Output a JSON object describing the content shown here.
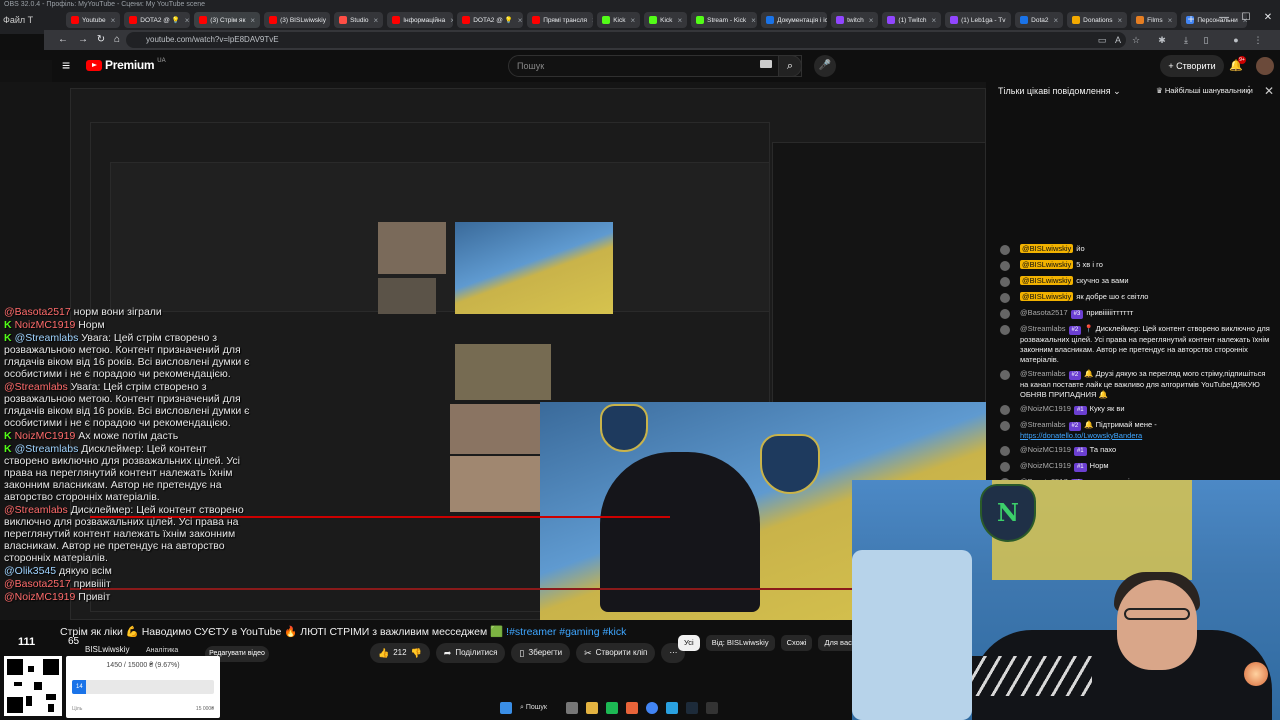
{
  "obs_title": "OBS 32.0.4 - Профіль: MyYouTube - Сцени: My YouTube scene",
  "left_menu": "Файл Т",
  "tabs": [
    {
      "label": "Youtube",
      "color": "#ff0000"
    },
    {
      "label": "DOTA2 @ 💡",
      "color": "#ff0000"
    },
    {
      "label": "(3) Стрім як",
      "color": "#ff0000",
      "active": true
    },
    {
      "label": "(3) BISLwiwskiy",
      "color": "#ff0000"
    },
    {
      "label": "Studio",
      "color": "#ff4e45"
    },
    {
      "label": "Інформаційна",
      "color": "#ff0000"
    },
    {
      "label": "DOTA2 @ 💡",
      "color": "#ff0000"
    },
    {
      "label": "Прямі трансля",
      "color": "#ff0000"
    },
    {
      "label": "Kick",
      "color": "#53fc18"
    },
    {
      "label": "Kick",
      "color": "#53fc18"
    },
    {
      "label": "Stream - Kick",
      "color": "#53fc18"
    },
    {
      "label": "Документація і історія",
      "color": "#1a73e8"
    },
    {
      "label": "twitch",
      "color": "#9146ff"
    },
    {
      "label": "(1) Twitch",
      "color": "#9146ff"
    },
    {
      "label": "(1) Leb1ga - Tv",
      "color": "#9146ff"
    },
    {
      "label": "Dota2",
      "color": "#1a73e8"
    },
    {
      "label": "Donations",
      "color": "#f2a900"
    },
    {
      "label": "Films",
      "color": "#e67e22"
    },
    {
      "label": "Персональни",
      "color": "#4285f4"
    }
  ],
  "address": "youtube.com/watch?v=lpE8DAV9TvE",
  "yt": {
    "logo": "Premium",
    "region": "UA",
    "search_placeholder": "Пошук",
    "create_label": "Створити",
    "notif_count": "9+"
  },
  "overlay_chat": [
    {
      "name": "@Basota2517",
      "red": true,
      "text": "норм вони зіграли",
      "kick": false
    },
    {
      "name": "NoizMC1919",
      "red": true,
      "text": "Норм",
      "kick": true
    },
    {
      "name": "@Streamlabs",
      "red": false,
      "text": "Увага: Цей стрім створено з розважальною метою. Контент призначений для глядачів віком від 16 років. Всі висловлені думки є особистими і не є порадою чи рекомендацією.",
      "kick": true
    },
    {
      "name": "@Streamlabs",
      "red": true,
      "text": "Увага: Цей стрім створено з розважальною метою. Контент призначений для глядачів віком від 16 років. Всі висловлені думки є особистими і не є порадою чи рекомендацією.",
      "kick": false
    },
    {
      "name": "NoizMC1919",
      "red": true,
      "text": "Ах може потім дасть",
      "kick": true
    },
    {
      "name": "@Streamlabs",
      "red": false,
      "text": "Дисклеймер: Цей контент створено виключно для розважальних цілей. Усі права на переглянутий контент належать їхнім законним власникам. Автор не претендує на авторство сторонніх матеріалів.",
      "kick": true
    },
    {
      "name": "@Streamlabs",
      "red": true,
      "text": "Дисклеймер: Цей контент створено виключно для розважальних цілей. Усі права на переглянутий контент належать їхнім законним власникам. Автор не претендує на авторство сторонніх матеріалів.",
      "kick": false
    },
    {
      "name": "@Olik3545",
      "red": false,
      "text": "дякую всім",
      "kick": false
    },
    {
      "name": "@Basota2517",
      "red": true,
      "text": "привііііт",
      "kick": false
    },
    {
      "name": "@NoizMC1919",
      "red": true,
      "text": "Привіт",
      "kick": false
    }
  ],
  "stream_title": "Стрім як ліки 💪 Наводимо СУЄТУ в YouTube 🔥 ЛЮТІ СТРІМИ з важливим месседжем 🟩",
  "stream_tags": "!#streamer #gaming #kick",
  "viewers_yt": "111",
  "viewers_kick": "65",
  "channel": "BISLwiwskiy",
  "analytics_label": "Аналітика",
  "edit_video_label": "Редагувати відео",
  "actions": {
    "likes": "212",
    "share": "Поділитися",
    "save": "Зберегти",
    "clip": "Створити кліп"
  },
  "chips": [
    "Усі",
    "Від: BISLwiwskiy",
    "Схожі",
    "Для вас"
  ],
  "goal": {
    "text": "1450 / 15000 ₴ (9.67%)",
    "progress_pct": 9.67,
    "fill_label": "14",
    "min": "Ціль",
    "max": "15 000₴"
  },
  "taskbar_search": "Пошук",
  "chat": {
    "mode": "Тільки цікаві повідомлення",
    "sort": "Найбільші шанувальники",
    "messages": [
      {
        "author": "@BISLwiwskiy",
        "hl": true,
        "badge": "",
        "text": "йо",
        "link": ""
      },
      {
        "author": "@BISLwiwskiy",
        "hl": true,
        "badge": "",
        "text": "5 хв і го",
        "link": ""
      },
      {
        "author": "@BISLwiwskiy",
        "hl": true,
        "badge": "",
        "text": "скучно за вами",
        "link": ""
      },
      {
        "author": "@BISLwiwskiy",
        "hl": true,
        "badge": "",
        "text": "як добре шо є світло",
        "link": ""
      },
      {
        "author": "@Basota2517",
        "hl": false,
        "badge": "#3",
        "text": "привіііііітттттт",
        "link": ""
      },
      {
        "author": "@Streamlabs",
        "hl": false,
        "badge": "#2",
        "text": "📍 Дисклеймер: Цей контент створено виключно для розважальних цілей. Усі права на переглянутий контент належать їхнім законним власникам. Автор не претендує на авторство сторонніх матеріалів.",
        "link": ""
      },
      {
        "author": "@Streamlabs",
        "hl": false,
        "badge": "#2",
        "text": "🔔 Друзі дякую за перегляд мого стріму,підпишіться на канал поставте лайк це важливо для алгоритмів YouTube!ДЯКУЮ ОБНЯВ ПРИПАДНИЯ 🔔",
        "link": ""
      },
      {
        "author": "@NoizMC1919",
        "hl": false,
        "badge": "#1",
        "text": "Куку як ви",
        "link": ""
      },
      {
        "author": "@Streamlabs",
        "hl": false,
        "badge": "#2",
        "text": "🔔 Підтримай мене - ",
        "link": "https://donatello.to/LwowskyBandera"
      },
      {
        "author": "@NoizMC1919",
        "hl": false,
        "badge": "#1",
        "text": "Та пахо",
        "link": ""
      },
      {
        "author": "@NoizMC1919",
        "hl": false,
        "badge": "#1",
        "text": "Норм",
        "link": ""
      },
      {
        "author": "@Basota2517",
        "hl": false,
        "badge": "#3",
        "text": "норм вони зіграли",
        "link": ""
      }
    ]
  }
}
